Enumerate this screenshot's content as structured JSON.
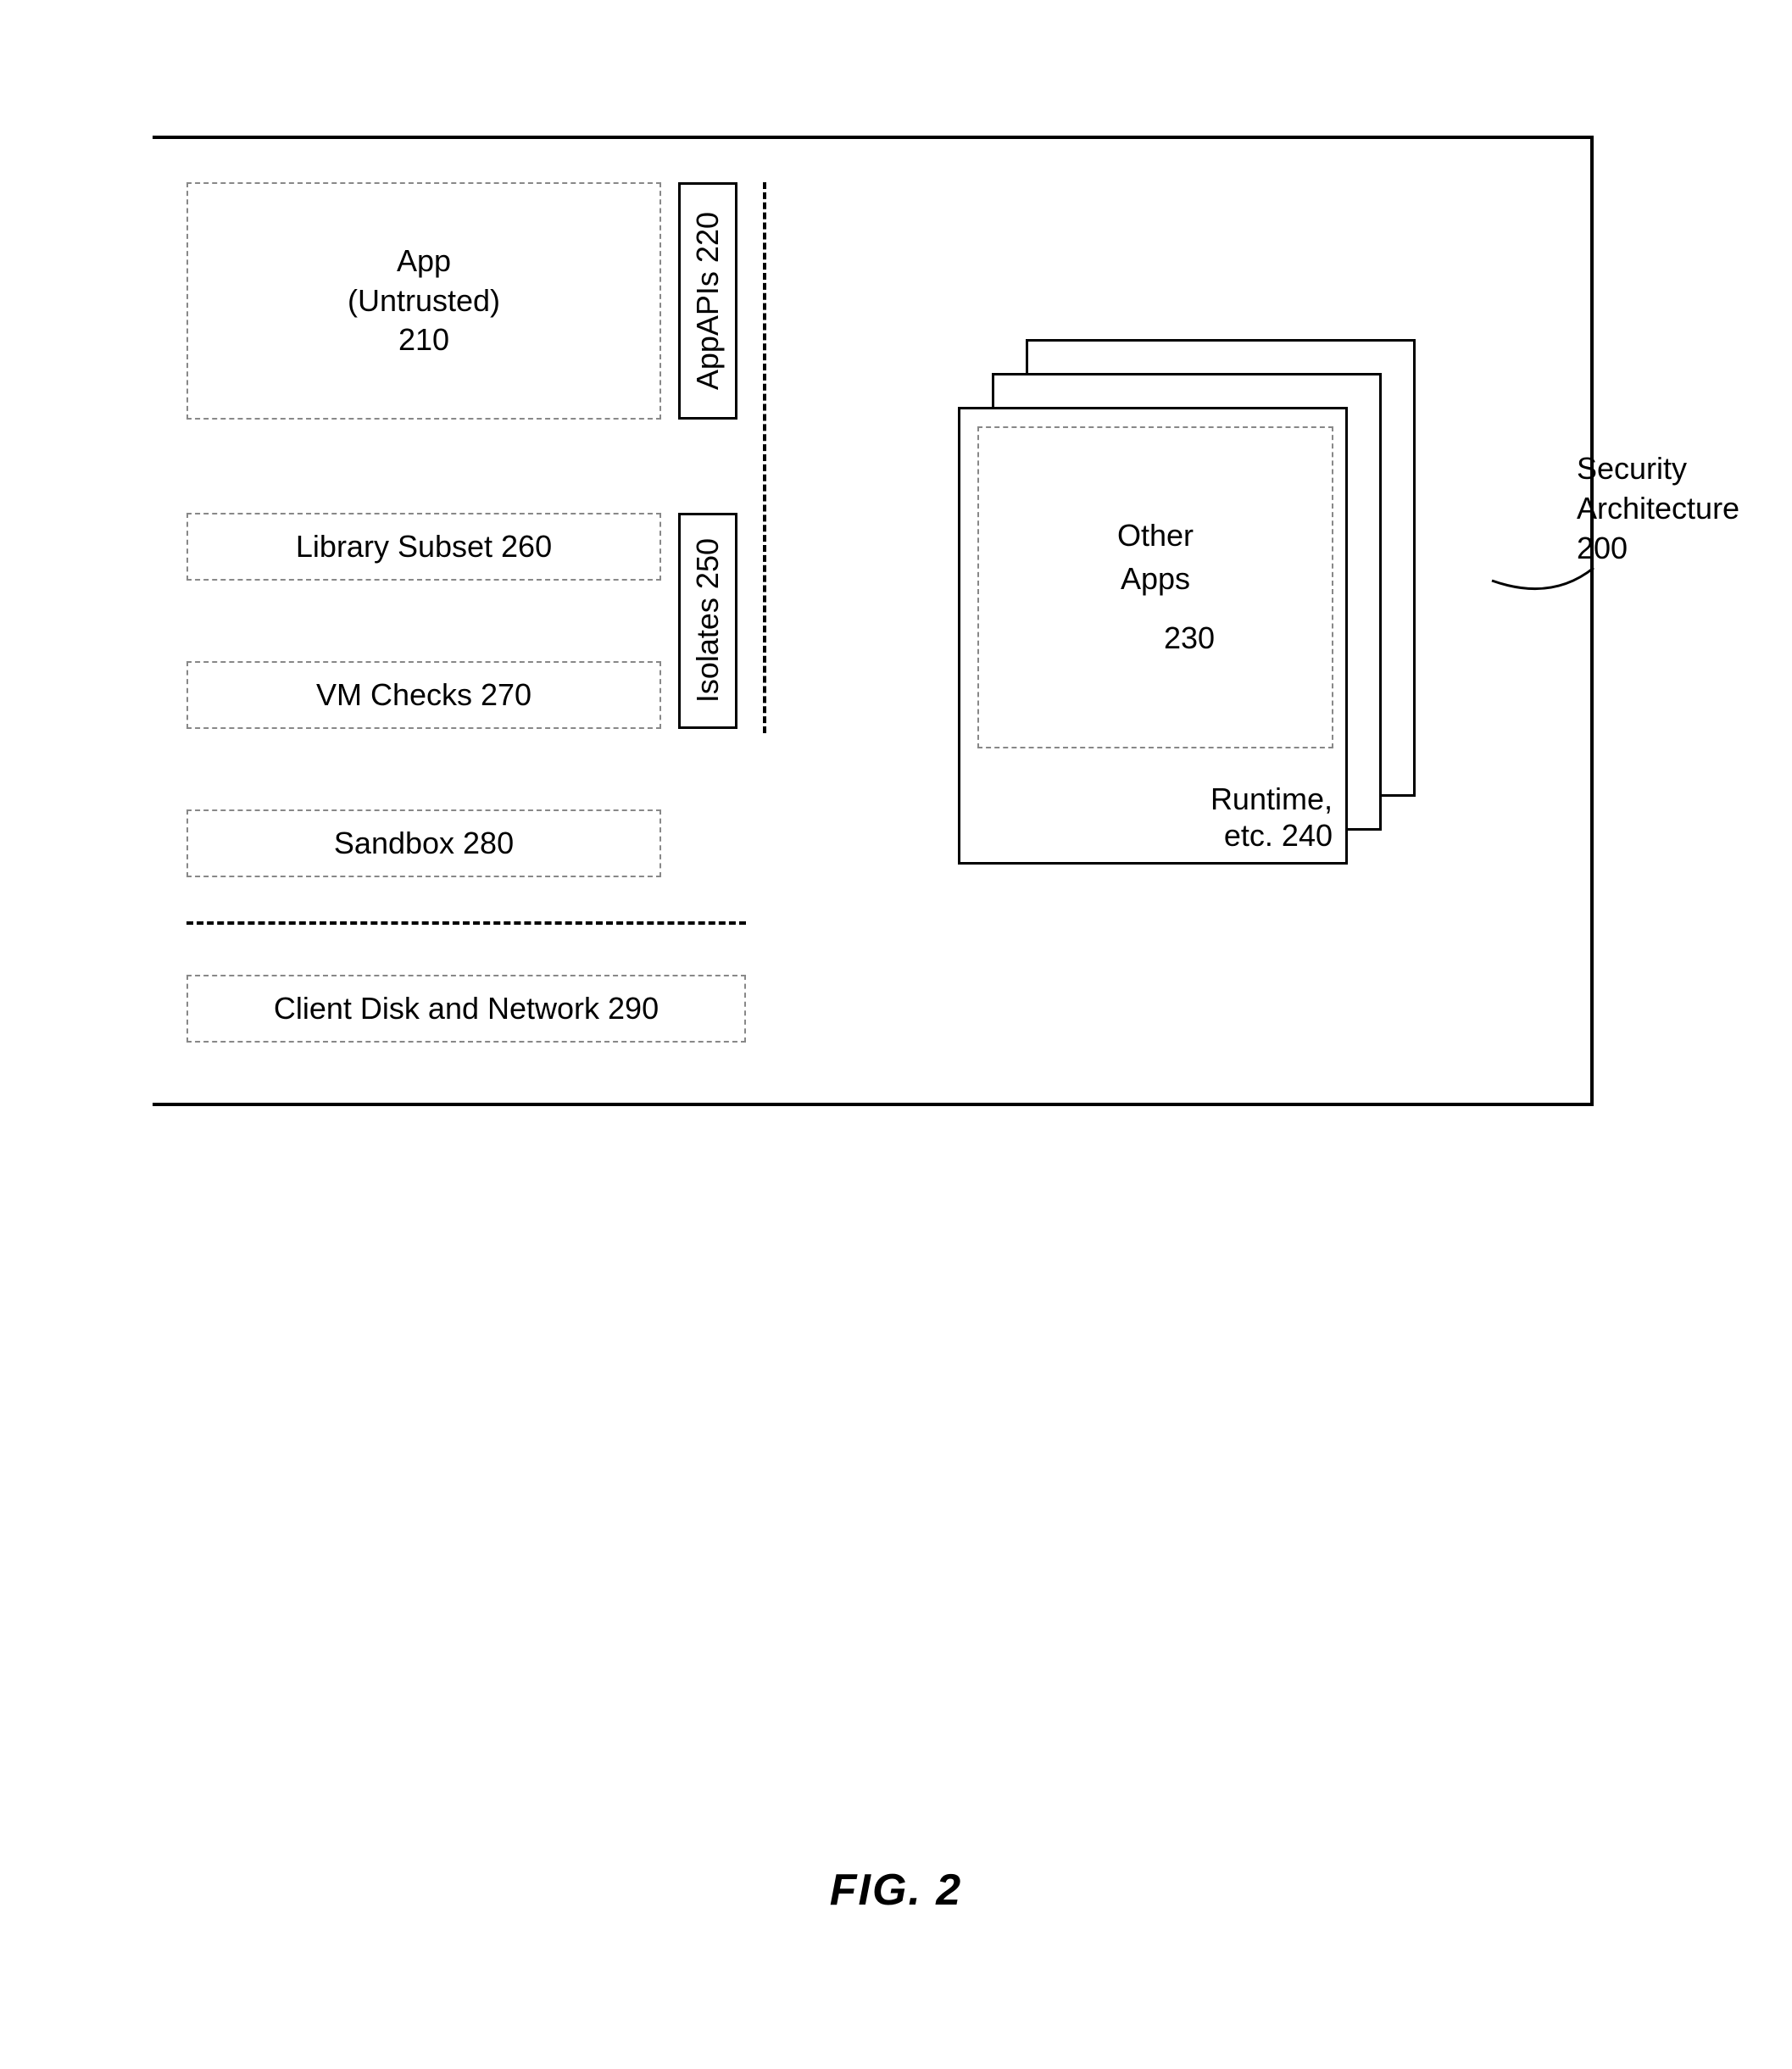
{
  "blocks": {
    "app": {
      "line1": "App",
      "line2": "(Untrusted)",
      "num": "210"
    },
    "appapis": "AppAPIs 220",
    "library": "Library Subset 260",
    "vmchecks": "VM Checks 270",
    "isolates": "Isolates 250",
    "sandbox": "Sandbox 280",
    "clientdisk": "Client Disk and Network 290",
    "otherapps": {
      "line1": "Other",
      "line2": "Apps",
      "num": "230"
    },
    "runtime": {
      "line1": "Runtime,",
      "line2": "etc. 240"
    }
  },
  "labels": {
    "architecture": {
      "line1": "Security",
      "line2": "Architecture",
      "num": "200"
    },
    "figure": "FIG. 2"
  }
}
